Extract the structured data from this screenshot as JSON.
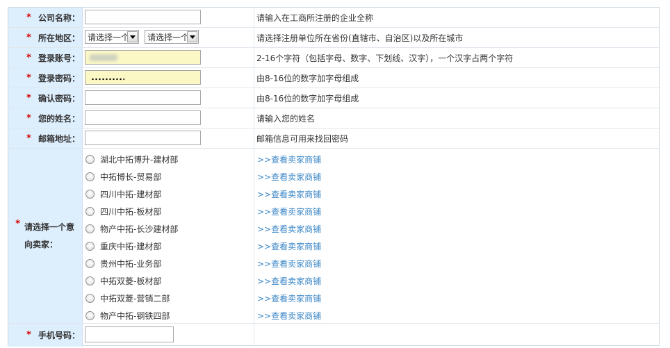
{
  "form": {
    "company": {
      "label": "公司名称：",
      "hint": "请输入在工商所注册的企业全称"
    },
    "region": {
      "label": "所在地区：",
      "select1": "请选择一个",
      "select2": "请选择一个",
      "hint": "请选择注册单位所在省份(直辖市、自治区)以及所在城市"
    },
    "account": {
      "label": "登录账号：",
      "hint": "2-16个字符（包括字母、数字、下划线、汉字），一个汉字占两个字符"
    },
    "password": {
      "label": "登录密码：",
      "hint": "由8-16位的数字加字母组成"
    },
    "confirm": {
      "label": "确认密码：",
      "hint": "由8-16位的数字加字母组成"
    },
    "name": {
      "label": "您的姓名：",
      "hint": "请输入您的姓名"
    },
    "email": {
      "label": "邮箱地址：",
      "hint": "邮箱信息可用来找回密码"
    },
    "seller_label": "请选择一个意向卖家：",
    "sellers": [
      {
        "name": "湖北中拓博升-建材部",
        "link": ">>查看卖家商铺"
      },
      {
        "name": "中拓博长-贸易部",
        "link": ">>查看卖家商铺"
      },
      {
        "name": "四川中拓-建材部",
        "link": ">>查看卖家商铺"
      },
      {
        "name": "四川中拓-板材部",
        "link": ">>查看卖家商铺"
      },
      {
        "name": "物产中拓-长沙建材部",
        "link": ">>查看卖家商铺"
      },
      {
        "name": "重庆中拓-建材部",
        "link": ">>查看卖家商铺"
      },
      {
        "name": "贵州中拓-业务部",
        "link": ">>查看卖家商铺"
      },
      {
        "name": "中拓双菱-板材部",
        "link": ">>查看卖家商铺"
      },
      {
        "name": "中拓双菱-营销二部",
        "link": ">>查看卖家商铺"
      },
      {
        "name": "物产中拓-钢铁四部",
        "link": ">>查看卖家商铺"
      }
    ],
    "phone": {
      "label": "手机号码："
    }
  },
  "star": "*",
  "colors": {
    "label_bg": "#ddeefd",
    "link": "#3c87c6",
    "required": "#d40000",
    "autofill": "#fbf8c6"
  }
}
